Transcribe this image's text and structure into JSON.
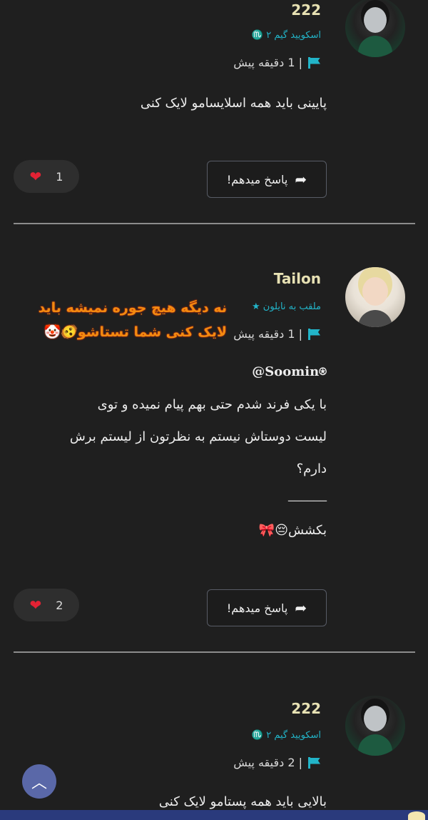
{
  "comments": [
    {
      "username": "222",
      "subtitle": "اسکویید گیم ۲ ♏️",
      "time": "| 1 دقیقه پیش",
      "body": "پایینی باید همه اسلایسامو لایک کنی",
      "reply_label": "پاسخ میدهم!",
      "likes": "1"
    },
    {
      "username": "Tailon",
      "subtitle": "ملقب به نایلون ★",
      "time": "| 1 دقیقه پیش",
      "mention": "@Soomin⍟",
      "body_lines": [
        "با یکی فرند شدم حتی بهم پیام نمیده و توی",
        "لیست دوستاش نیستم به نظرتون از لیستم برش",
        "دارم؟"
      ],
      "rule": "______",
      "tail": "بکشش😔🎀",
      "reply_label": "پاسخ میدهم!",
      "likes": "2"
    },
    {
      "username": "222",
      "subtitle": "اسکویید گیم ۲ ♏️",
      "time": "| 2 دقیقه پیش",
      "body": "بالایی باید همه پستامو لایک کنی"
    }
  ],
  "overlay": {
    "line1": "نه دیگه هیچ جوره نمیشه باید",
    "line2": "لایک کنی شما تستاشو🫨🤡"
  },
  "icons": {
    "flag": "flag-icon",
    "reply": "reply-arrow-icon",
    "heart": "heart-icon",
    "scroll_top": "chevron-up-icon"
  },
  "colors": {
    "background": "#1f1f1f",
    "accent": "#22b4c8",
    "username": "#e7e1b3",
    "heart": "#e32234",
    "overlay": "#f28a10",
    "scroll_button": "#5a68a8"
  }
}
